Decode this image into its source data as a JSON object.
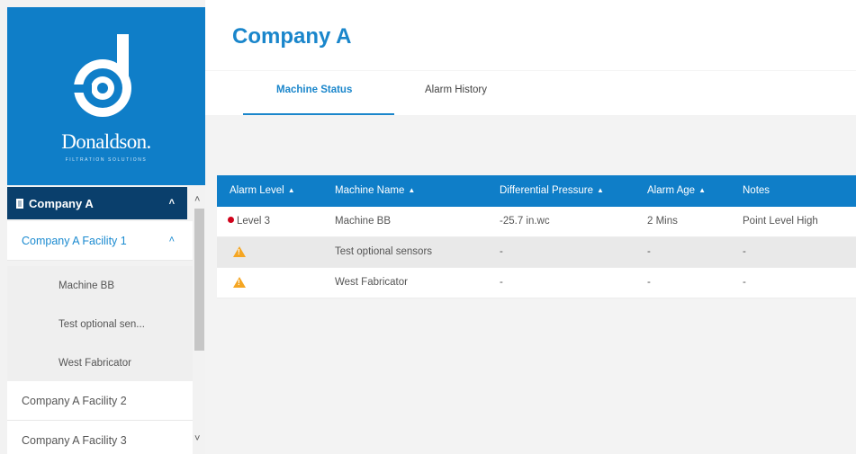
{
  "brand": {
    "name": "Donaldson.",
    "tagline": "FILTRATION SOLUTIONS"
  },
  "sidebar": {
    "company": {
      "label": "Company A",
      "icon": "building-icon"
    },
    "facilities": [
      {
        "label": "Company A Facility 1",
        "expanded": true,
        "machines": [
          "Machine BB",
          "Test optional sen...",
          "West Fabricator"
        ]
      },
      {
        "label": "Company A Facility 2"
      },
      {
        "label": "Company A Facility 3"
      }
    ]
  },
  "page": {
    "title": "Company A"
  },
  "tabs": [
    {
      "label": "Machine Status",
      "active": true
    },
    {
      "label": "Alarm History",
      "active": false
    }
  ],
  "table": {
    "columns": [
      "Alarm Level",
      "Machine Name",
      "Differential Pressure",
      "Alarm Age",
      "Notes"
    ],
    "rows": [
      {
        "alarm_level": "Level 3",
        "status": "red-dot",
        "machine": "Machine BB",
        "pressure": "-25.7 in.wc",
        "age": "2 Mins",
        "notes": "Point Level High"
      },
      {
        "alarm_level": "",
        "status": "warning-icon",
        "machine": "Test optional sensors",
        "pressure": "-",
        "age": "-",
        "notes": "-"
      },
      {
        "alarm_level": "",
        "status": "warning-icon",
        "machine": "West Fabricator",
        "pressure": "-",
        "age": "-",
        "notes": "-"
      }
    ]
  },
  "colors": {
    "primary": "#0f7ec8",
    "dark": "#0a3f6c",
    "alarm_red": "#d0021b",
    "warning": "#f5a623"
  }
}
